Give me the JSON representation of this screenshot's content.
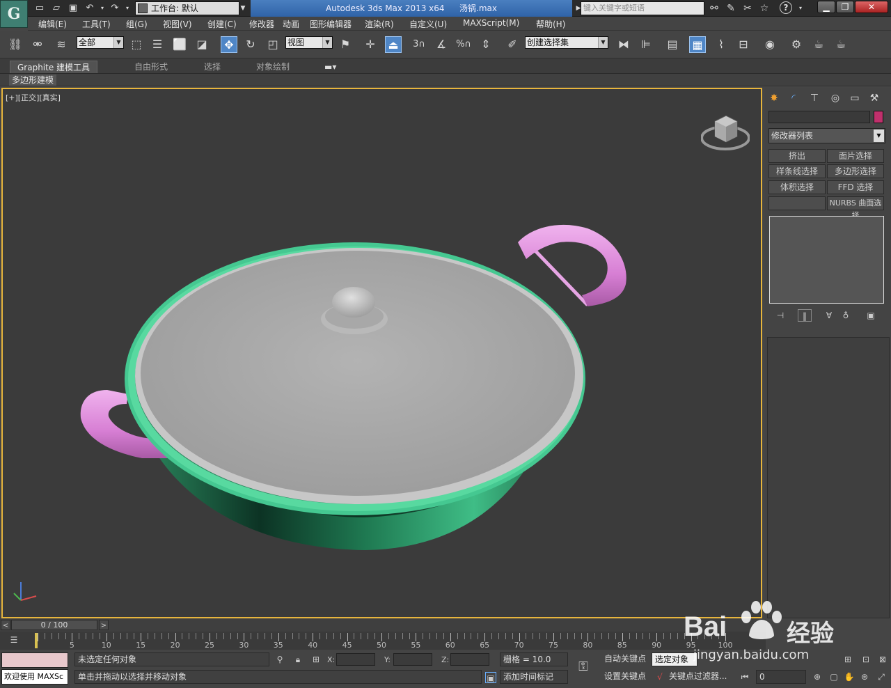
{
  "titlebar": {
    "workspace_label": "工作台: 默认",
    "product": "Autodesk 3ds Max  2013 x64",
    "filename": "汤锅.max",
    "search_placeholder": "键入关键字或短语",
    "app_logo": "G"
  },
  "menu": [
    "编辑(E)",
    "工具(T)",
    "组(G)",
    "视图(V)",
    "创建(C)",
    "修改器",
    "动画",
    "图形编辑器",
    "渲染(R)",
    "自定义(U)",
    "MAXScript(M)",
    "帮助(H)"
  ],
  "toolbar": {
    "selection_filter": "全部",
    "ref_coord": "视图",
    "named_selection": "创建选择集",
    "snap_3": "3",
    "percent": "%"
  },
  "ribbon": {
    "tabs": [
      "Graphite 建模工具",
      "自由形式",
      "选择",
      "对象绘制"
    ],
    "sub_label": "多边形建模"
  },
  "viewport": {
    "label": "[+][正交][真实]",
    "accent_color": "#e7b53c"
  },
  "command_panel": {
    "modifier_list": "修改器列表",
    "buttons": [
      "挤出",
      "面片选择",
      "样条线选择",
      "多边形选择",
      "体积选择",
      "FFD 选择",
      "",
      "NURBS 曲面选择"
    ],
    "object_color": "#c0306c"
  },
  "timeline": {
    "frame_display": "0 / 100",
    "ticks": [
      0,
      5,
      10,
      15,
      20,
      25,
      30,
      35,
      40,
      45,
      50,
      55,
      60,
      65,
      70,
      75,
      80,
      85,
      90,
      95,
      100
    ],
    "tick_labels": [
      "5",
      "10",
      "15",
      "20",
      "25",
      "30",
      "35",
      "40",
      "45",
      "50",
      "55",
      "60",
      "65",
      "70",
      "75",
      "80",
      "85",
      "90",
      "95",
      "100"
    ]
  },
  "status": {
    "maxscript_welcome": "欢迎使用 MAXSc",
    "selection_status": "未选定任何对象",
    "prompt": "单击并拖动以选择并移动对象",
    "x_label": "X:",
    "y_label": "Y:",
    "z_label": "Z:",
    "grid": "栅格 = 10.0",
    "add_time_tag": "添加时间标记",
    "auto_key": "自动关键点",
    "set_key": "设置关键点",
    "selected_object": "选定对象",
    "key_filters": "关键点过滤器...",
    "frame_field": "0"
  },
  "watermark": {
    "brand": "Bai",
    "brand_cn": "经验",
    "url": "jingyan.baidu.com"
  }
}
